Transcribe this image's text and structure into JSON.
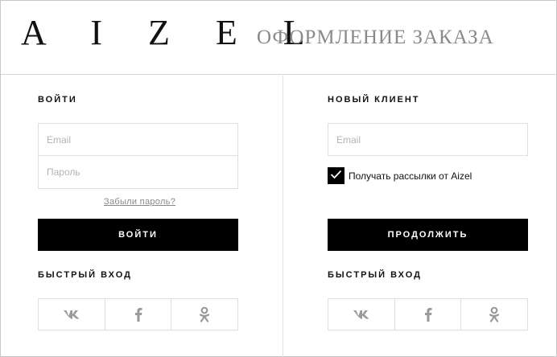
{
  "header": {
    "logo": "A I Z E L",
    "title": "ОФОРМЛЕНИЕ ЗАКАЗА"
  },
  "login": {
    "heading": "ВОЙТИ",
    "email_placeholder": "Email",
    "password_placeholder": "Пароль",
    "forgot_link": "Забыли пароль?",
    "submit_label": "ВОЙТИ",
    "quick_login_heading": "БЫСТРЫЙ ВХОД"
  },
  "new_client": {
    "heading": "НОВЫЙ КЛИЕНТ",
    "email_placeholder": "Email",
    "newsletter_label": "Получать рассылки от Aizel",
    "newsletter_checked": true,
    "submit_label": "ПРОДОЛЖИТЬ",
    "quick_login_heading": "БЫСТРЫЙ ВХОД"
  },
  "social": {
    "icons": [
      "vk-icon",
      "facebook-icon",
      "odnoklassniki-icon"
    ],
    "icon_color": "#9a9a9a"
  },
  "colors": {
    "accent": "#000000",
    "title_gray": "#8a8a8a"
  }
}
